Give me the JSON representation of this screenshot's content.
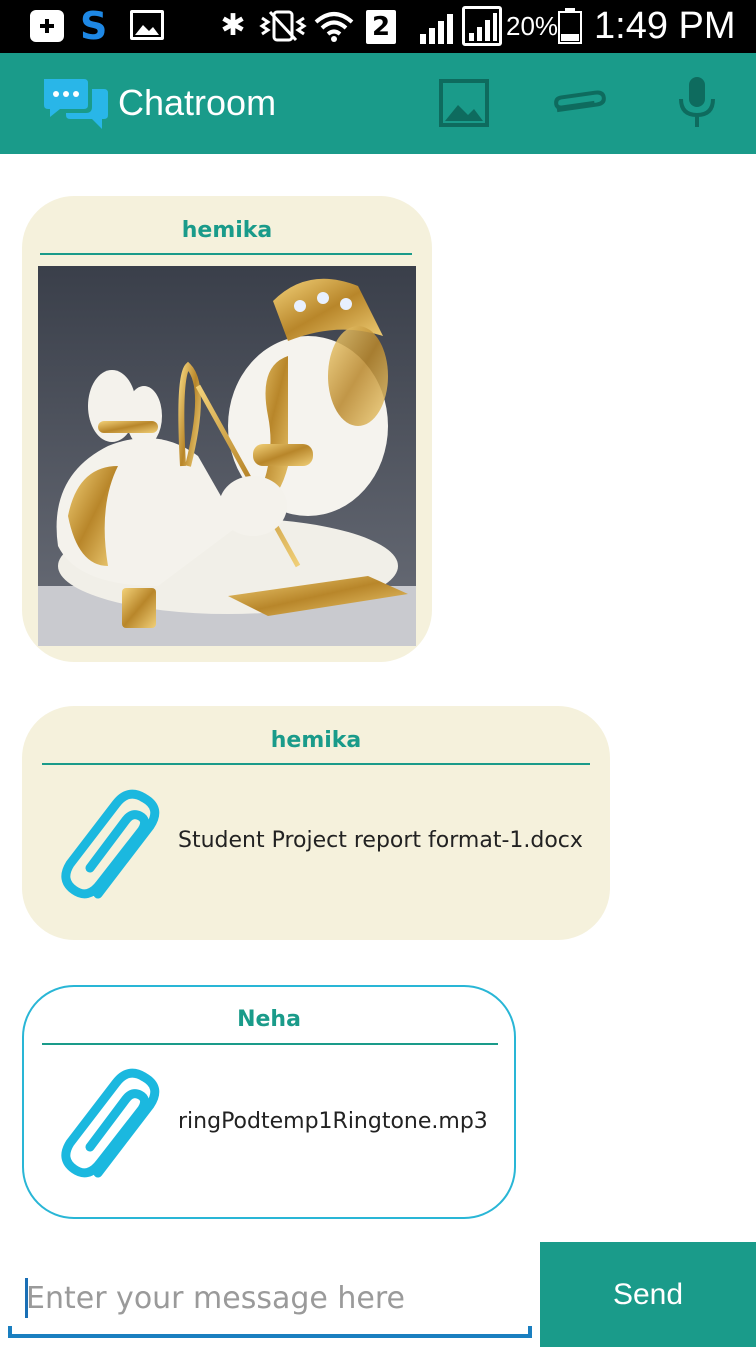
{
  "status_bar": {
    "badge": "2",
    "battery": "20%",
    "time": "1:49 PM",
    "icons": [
      "notification-plus-icon",
      "s-app-icon",
      "image-icon",
      "bluetooth-icon",
      "vibrate-icon",
      "wifi-icon",
      "sim-2-icon",
      "signal-icon",
      "signal-r-icon",
      "battery-icon"
    ]
  },
  "app_bar": {
    "title": "Chatroom",
    "actions": [
      "gallery-icon",
      "attach-icon",
      "mic-icon"
    ],
    "color": "#1a9b8a"
  },
  "messages": [
    {
      "sender": "hemika",
      "type": "image",
      "content": "Ganesha figurine image",
      "bubble_color": "#f5f1dc"
    },
    {
      "sender": "hemika",
      "type": "file",
      "file_name": "Student Project report format-1.docx",
      "bubble_color": "#f5f1dc"
    },
    {
      "sender": "Neha",
      "type": "file",
      "file_name": "ringPodtemp1Ringtone.mp3",
      "bubble_color": "#ffffff"
    }
  ],
  "composer": {
    "placeholder": "Enter your message here",
    "value": "",
    "send_label": "Send"
  }
}
